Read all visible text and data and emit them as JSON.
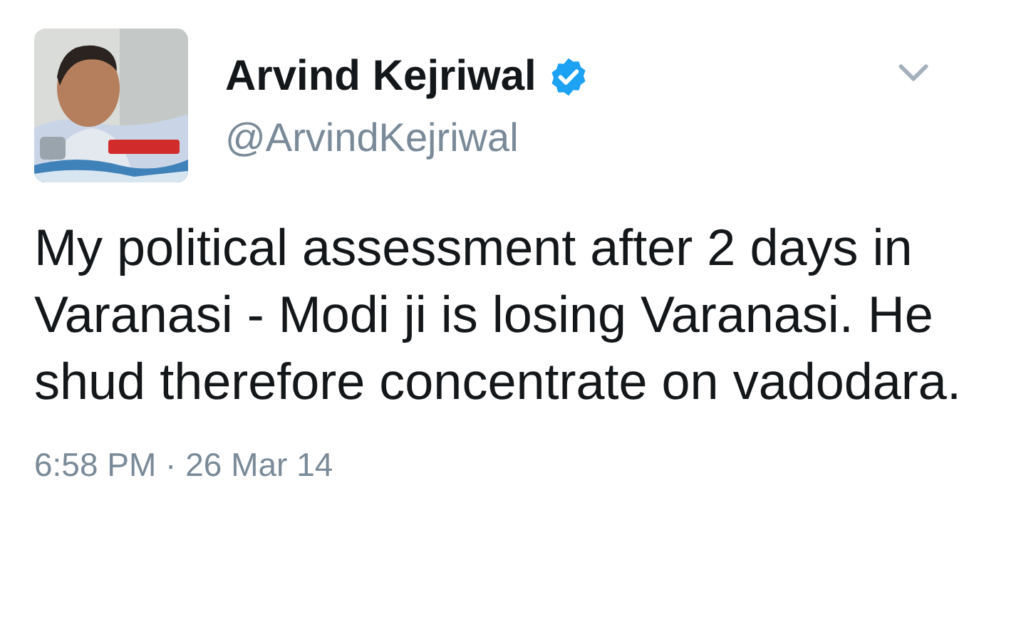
{
  "tweet": {
    "author": {
      "name": "Arvind Kejriwal",
      "verified": true,
      "handle": "@ArvindKejriwal"
    },
    "text": "My political assessment after 2 days in Varanasi - Modi ji is losing Varanasi. He shud therefore concentrate on vadodara.",
    "timestamp": "6:58 PM · 26 Mar 14"
  }
}
